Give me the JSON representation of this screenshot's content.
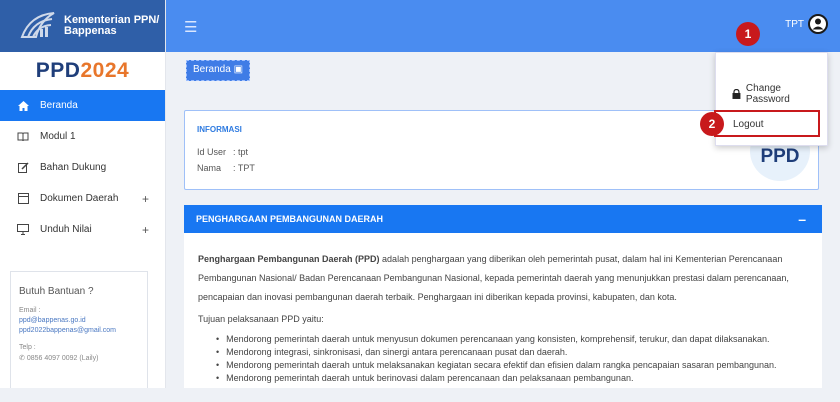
{
  "brand": {
    "line1": "Kementerian PPN/",
    "line2": "Bappenas"
  },
  "sidebar": {
    "title_a": "PPD",
    "title_b": "2024",
    "items": [
      {
        "label": "Beranda"
      },
      {
        "label": "Modul 1"
      },
      {
        "label": "Bahan Dukung"
      },
      {
        "label": "Dokumen Daerah"
      },
      {
        "label": "Unduh Nilai"
      }
    ],
    "plus": "+",
    "help": {
      "heading": "Butuh Bantuan ?",
      "email_label": "Email :",
      "email1": "ppd@bappenas.go.id",
      "email2": "ppd2022bappenas@gmail.com",
      "phone_label": "Telp :",
      "phone": "0856 4097 0092 (Laily)"
    }
  },
  "topbar": {
    "username": "TPT"
  },
  "breadcrumb": "Beranda",
  "info": {
    "title": "INFORMASI",
    "id_label": "Id User",
    "id_value": ": tpt",
    "name_label": "Nama",
    "name_value": ": TPT",
    "logo_text": "PPD"
  },
  "award": {
    "header": "PENGHARGAAN PEMBANGUNAN DAERAH",
    "collapse": "–",
    "bold_intro": "Penghargaan Pembangunan Daerah (PPD)",
    "intro_rest": " adalah penghargaan yang diberikan oleh pemerintah pusat, dalam hal ini Kementerian Perencanaan Pembangunan Nasional/ Badan Perencanaan Pembangunan Nasional, kepada pemerintah daerah yang menunjukkan prestasi dalam perencanaan, pencapaian dan inovasi pembangunan daerah terbaik. Penghargaan ini diberikan kepada provinsi, kabupaten, dan kota.",
    "goals_title": "Tujuan pelaksanaan PPD yaitu:",
    "goals": [
      "Mendorong pemerintah daerah untuk menyusun dokumen perencanaan yang konsisten, komprehensif, terukur, dan dapat dilaksanakan.",
      "Mendorong integrasi, sinkronisasi, dan sinergi antara perencanaan pusat dan daerah.",
      "Mendorong pemerintah daerah untuk melaksanakan kegiatan secara efektif dan efisien dalam rangka pencapaian sasaran pembangunan.",
      "Mendorong pemerintah daerah untuk berinovasi dalam perencanaan dan pelaksanaan pembangunan."
    ]
  },
  "dropdown": {
    "change_password": "Change Password",
    "logout": "Logout"
  },
  "badges": {
    "one": "1",
    "two": "2"
  },
  "colors": {
    "primary": "#1877f2",
    "topbar": "#4a8cf0",
    "brand": "#2f5fa8",
    "badge": "#c8191c",
    "accent": "#e8762b"
  }
}
